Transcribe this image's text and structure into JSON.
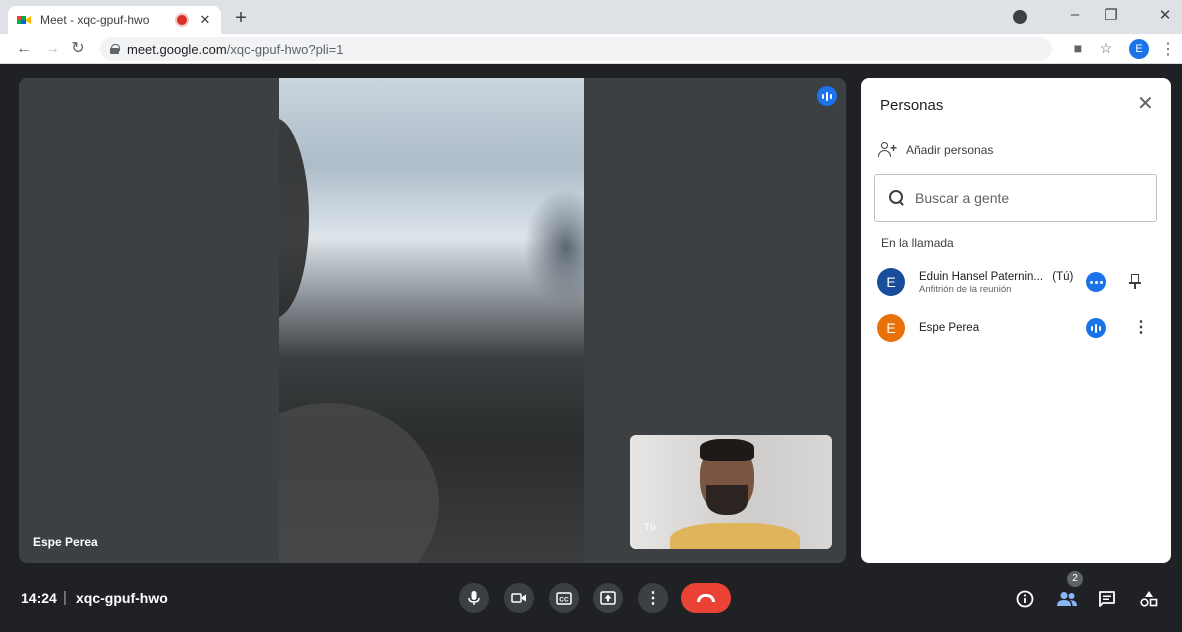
{
  "browser": {
    "tab_title": "Meet - xqc-gpuf-hwo",
    "url_domain": "meet.google.com",
    "url_path": "/xqc-gpuf-hwo?pli=1",
    "profile_initial": "E"
  },
  "stage": {
    "main_participant_name": "Espe Perea",
    "self_label": "Tú"
  },
  "panel": {
    "title": "Personas",
    "add_people_label": "Añadir personas",
    "search_placeholder": "Buscar a gente",
    "section_title": "En la llamada",
    "participants": [
      {
        "initial": "E",
        "name": "Eduin Hansel Paternin...",
        "suffix": "(Tú)",
        "role": "Anfitrión de la reunión",
        "avatar_color": "#1a4e9c"
      },
      {
        "initial": "E",
        "name": "Espe Perea",
        "suffix": "",
        "role": "",
        "avatar_color": "#e8710a"
      }
    ]
  },
  "bottombar": {
    "time": "14:24",
    "separator": "|",
    "meeting_code": "xqc-gpuf-hwo",
    "people_count": "2"
  },
  "colors": {
    "accent": "#1a73e8",
    "hangup": "#ea4335",
    "background": "#202124"
  }
}
